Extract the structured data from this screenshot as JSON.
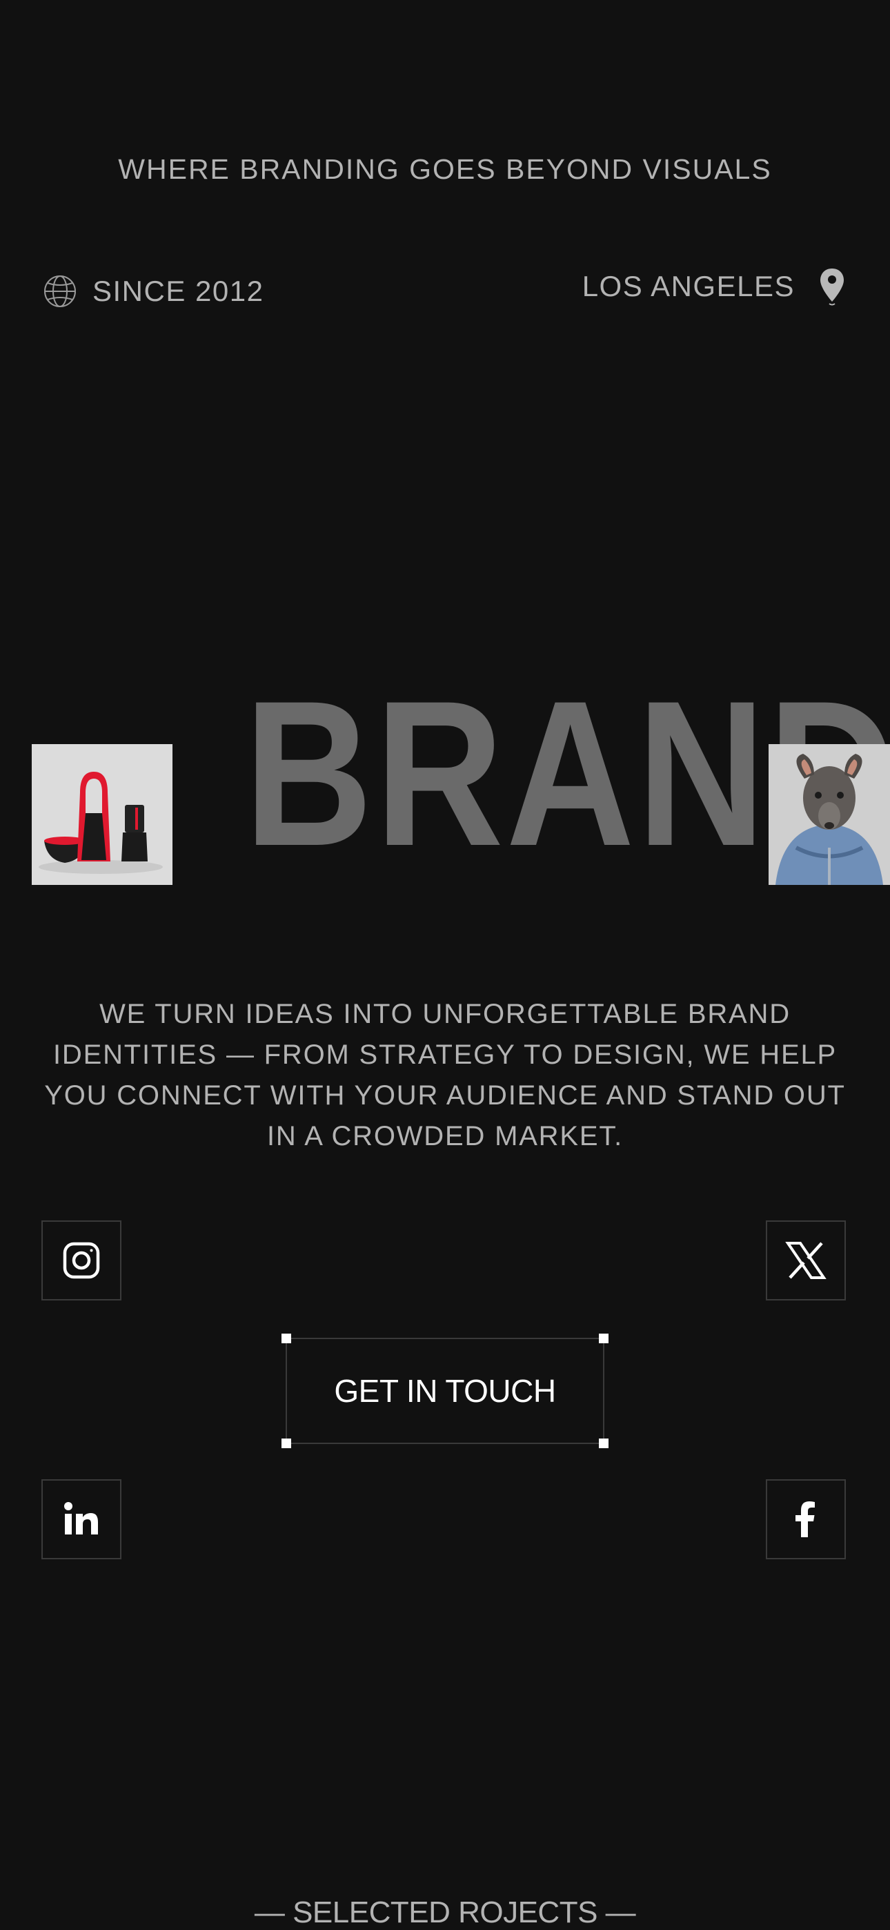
{
  "header": {
    "tagline": "WHERE BRANDING GOES BEYOND VISUALS",
    "since": "SINCE 2012",
    "location": "LOS ANGELES"
  },
  "hero": {
    "title": "BRAND",
    "left_image": "product-photo",
    "right_image": "dog-in-hoodie-photo"
  },
  "description": "WE TURN IDEAS INTO UNFORGETTABLE BRAND IDENTITIES — FROM STRATEGY TO DESIGN, WE HELP YOU CONNECT WITH YOUR AUDIENCE AND STAND OUT IN A CROWDED MARKET.",
  "cta": {
    "label": "GET IN TOUCH"
  },
  "socials": {
    "instagram_icon": "instagram-icon",
    "x_icon": "x-icon",
    "linkedin_icon": "linkedin-icon",
    "facebook_icon": "facebook-icon"
  },
  "section": {
    "heading": "— SELECTED ROJECTS —"
  },
  "colors": {
    "background": "#111111",
    "text": "#b3b3b3",
    "brand_word": "#6a6a6a",
    "border": "#3a3a3a",
    "accent_red": "#e0192f"
  }
}
